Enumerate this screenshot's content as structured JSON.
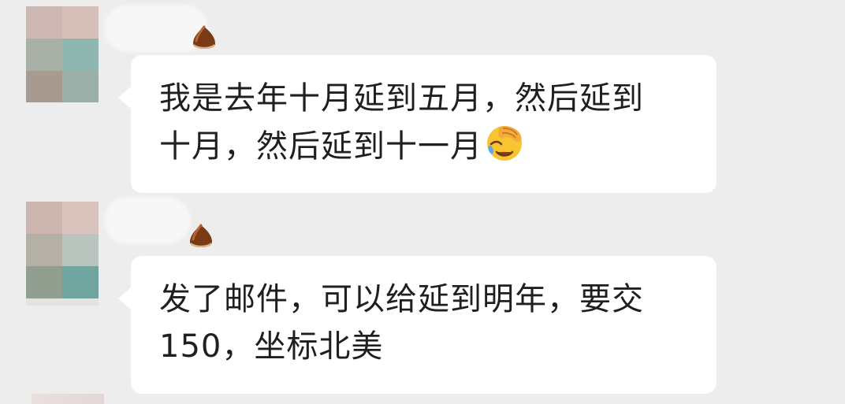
{
  "colors": {
    "background": "#ededed",
    "bubble": "#ffffff",
    "text": "#1f1f1f"
  },
  "messages": [
    {
      "lines": [
        "我是去年十月延到五月，然后延到",
        "十月，然后延到十一月"
      ],
      "trailing_emoji": "facepalm-crying-emoji",
      "sender_badge_icon": "chestnut-icon"
    },
    {
      "lines": [
        "发了邮件，可以给延到明年，要交",
        "150，坐标北美"
      ],
      "sender_badge_icon": "chestnut-icon"
    }
  ]
}
